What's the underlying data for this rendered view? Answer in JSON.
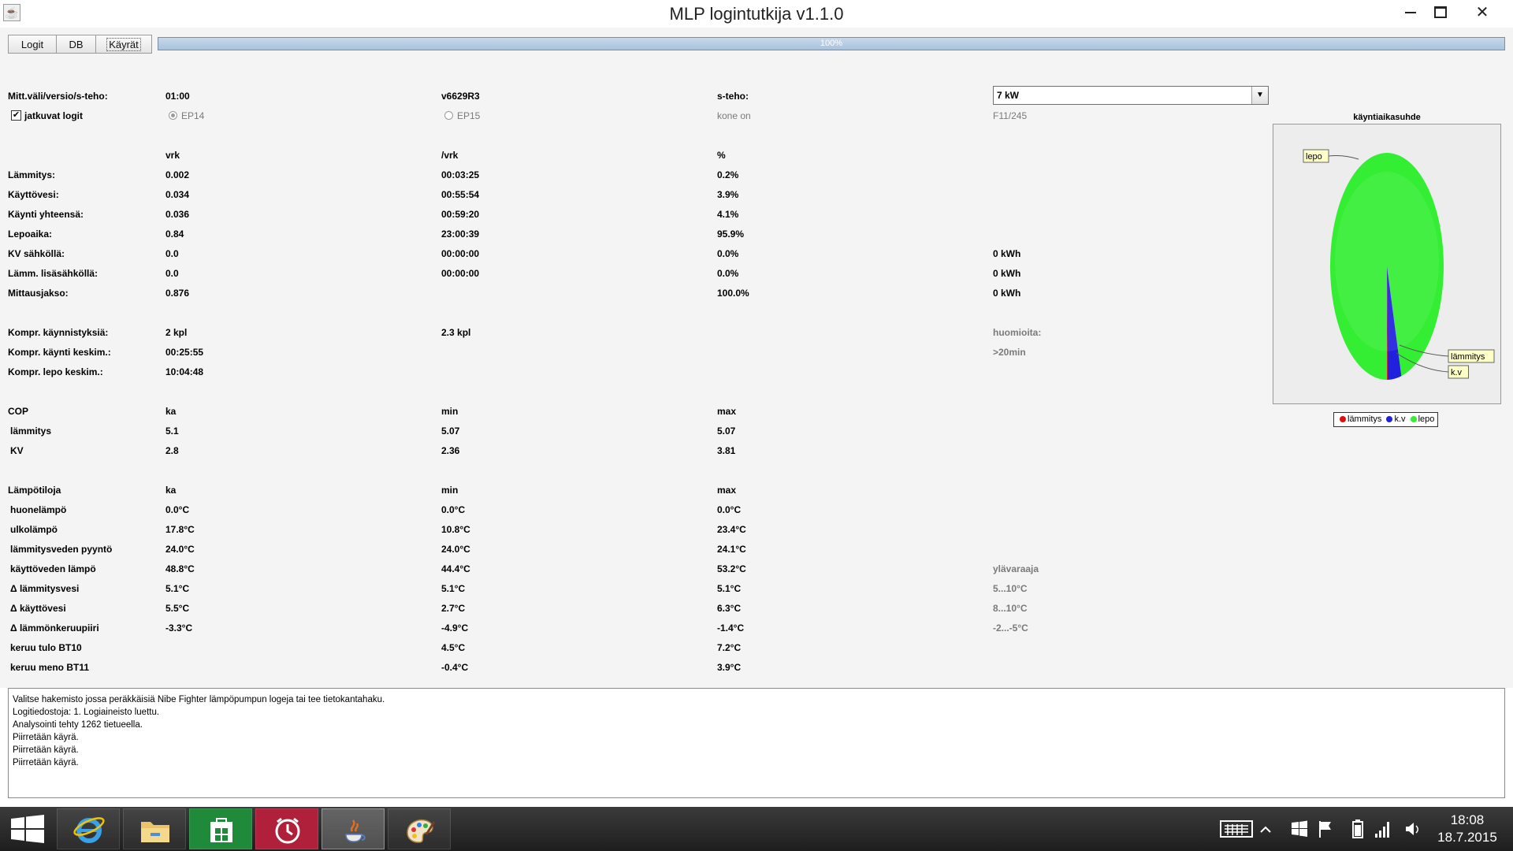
{
  "window": {
    "title": "MLP logintutkija v1.1.0",
    "close_glyph": "✕"
  },
  "toolbar": {
    "buttons": [
      "Logit",
      "DB",
      "Käyrät"
    ],
    "progress_text": "100%",
    "progress_value": 1.0
  },
  "settings": {
    "interval_label": "Mitt.väli/versio/s-teho:",
    "interval_value": "01:00",
    "version_value": "v6629R3",
    "power_label": "s-teho:",
    "power_select_value": "7 kW",
    "continuous_logs_label": "jatkuvat logit",
    "continuous_logs_checked": true,
    "ep14_label": "EP14",
    "ep15_label": "EP15",
    "kone_on_label": "kone on",
    "machine_value": "F11/245"
  },
  "runtime": {
    "headers": [
      "vrk",
      "/vrk",
      "%"
    ],
    "rows": [
      {
        "label": "Lämmitys:",
        "vrk": "0.002",
        "per_day": "00:03:25",
        "pct": "0.2%",
        "kwh": ""
      },
      {
        "label": "Käyttövesi:",
        "vrk": "0.034",
        "per_day": "00:55:54",
        "pct": "3.9%",
        "kwh": ""
      },
      {
        "label": "Käynti yhteensä:",
        "vrk": "0.036",
        "per_day": "00:59:20",
        "pct": "4.1%",
        "kwh": ""
      },
      {
        "label": "Lepoaika:",
        "vrk": "0.84",
        "per_day": "23:00:39",
        "pct": "95.9%",
        "kwh": ""
      },
      {
        "label": "KV sähköllä:",
        "vrk": "0.0",
        "per_day": "00:00:00",
        "pct": "0.0%",
        "kwh": "0 kWh"
      },
      {
        "label": "Lämm. lisäsähköllä:",
        "vrk": "0.0",
        "per_day": "00:00:00",
        "pct": "0.0%",
        "kwh": "0 kWh"
      },
      {
        "label": "Mittausjakso:",
        "vrk": "0.876",
        "per_day": "",
        "pct": "100.0%",
        "kwh": "0 kWh"
      }
    ]
  },
  "compressor": {
    "starts_label": "Kompr. käynnistyksiä:",
    "starts_value": "2 kpl",
    "starts_per_day": "2.3 kpl",
    "note_label": "huomioita:",
    "run_avg_label": "Kompr. käynti keskim.:",
    "run_avg_value": "00:25:55",
    "run_note": ">20min",
    "rest_avg_label": "Kompr. lepo keskim.:",
    "rest_avg_value": "10:04:48"
  },
  "cop": {
    "title": "COP",
    "headers": [
      "ka",
      "min",
      "max"
    ],
    "rows": [
      {
        "label": "lämmitys",
        "ka": "5.1",
        "min": "5.07",
        "max": "5.07"
      },
      {
        "label": "KV",
        "ka": "2.8",
        "min": "2.36",
        "max": "3.81"
      }
    ]
  },
  "temps": {
    "title": "Lämpötiloja",
    "headers": [
      "ka",
      "min",
      "max"
    ],
    "rows": [
      {
        "label": "huonelämpö",
        "ka": "0.0°C",
        "min": "0.0°C",
        "max": "0.0°C",
        "note": ""
      },
      {
        "label": "ulkolämpö",
        "ka": "17.8°C",
        "min": "10.8°C",
        "max": "23.4°C",
        "note": ""
      },
      {
        "label": "lämmitysveden pyyntö",
        "ka": "24.0°C",
        "min": "24.0°C",
        "max": "24.1°C",
        "note": ""
      },
      {
        "label": "käyttöveden lämpö",
        "ka": "48.8°C",
        "min": "44.4°C",
        "max": "53.2°C",
        "note": "ylävaraaja"
      },
      {
        "label": "Δ lämmitysvesi",
        "ka": "5.1°C",
        "min": "5.1°C",
        "max": "5.1°C",
        "note": "5...10°C"
      },
      {
        "label": "Δ käyttövesi",
        "ka": "5.5°C",
        "min": "2.7°C",
        "max": "6.3°C",
        "note": "8...10°C"
      },
      {
        "label": "Δ lämmönkeruupiiri",
        "ka": "-3.3°C",
        "min": "-4.9°C",
        "max": "-1.4°C",
        "note": "-2...-5°C"
      },
      {
        "label": "keruu tulo BT10",
        "ka": "",
        "min": "4.5°C",
        "max": "7.2°C",
        "note": ""
      },
      {
        "label": "keruu meno BT11",
        "ka": "",
        "min": "-0.4°C",
        "max": "3.9°C",
        "note": ""
      }
    ]
  },
  "chart_data": {
    "type": "pie",
    "title": "käyntiaikasuhde",
    "categories": [
      "lämmitys",
      "k.v",
      "lepo"
    ],
    "values": [
      0.2,
      3.9,
      95.9
    ],
    "colors": [
      "#e01010",
      "#2020dd",
      "#33ee33"
    ],
    "labels": [
      "lepo",
      "lämmitys",
      "k.v"
    ],
    "legend": "bottom"
  },
  "log": [
    "Valitse hakemisto jossa peräkkäisiä Nibe Fighter lämpöpumpun logeja tai tee tietokantahaku.",
    "Logitiedostoja: 1. Logiaineisto luettu.",
    "Analysointi tehty 1262 tietueella.",
    "Piirretään käyrä.",
    "Piirretään käyrä.",
    "Piirretään käyrä."
  ],
  "taskbar": {
    "apps": [
      "internet-explorer-icon",
      "file-explorer-icon",
      "store-icon",
      "alarms-icon",
      "java-icon",
      "paint-icon"
    ],
    "time": "18:08",
    "date": "18.7.2015"
  }
}
